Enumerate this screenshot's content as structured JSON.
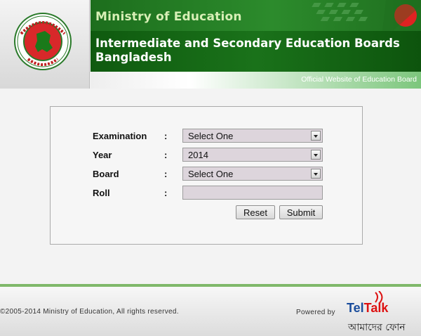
{
  "header": {
    "ministry": "Ministry of Education",
    "board_line1": "Intermediate and Secondary Education Boards",
    "board_line2": "Bangladesh",
    "official": "Official Website of Education Board",
    "colors": {
      "green_dark": "#0f5a0f",
      "green": "#2c8b2c",
      "seal_red": "#d8282a"
    }
  },
  "form": {
    "examination": {
      "label": "Examination",
      "colon": ":",
      "value": "Select One"
    },
    "year": {
      "label": "Year",
      "colon": ":",
      "value": "2014"
    },
    "board": {
      "label": "Board",
      "colon": ":",
      "value": "Select One"
    },
    "roll": {
      "label": "Roll",
      "colon": ":",
      "value": ""
    },
    "reset_label": "Reset",
    "submit_label": "Submit"
  },
  "footer": {
    "copyright": "©2005-2014 Ministry of Education, All rights reserved.",
    "powered_by": "Powered by",
    "brand_part1": "Tel",
    "brand_part2": "Talk",
    "brand_tagline": "আমাদের ফোন"
  }
}
